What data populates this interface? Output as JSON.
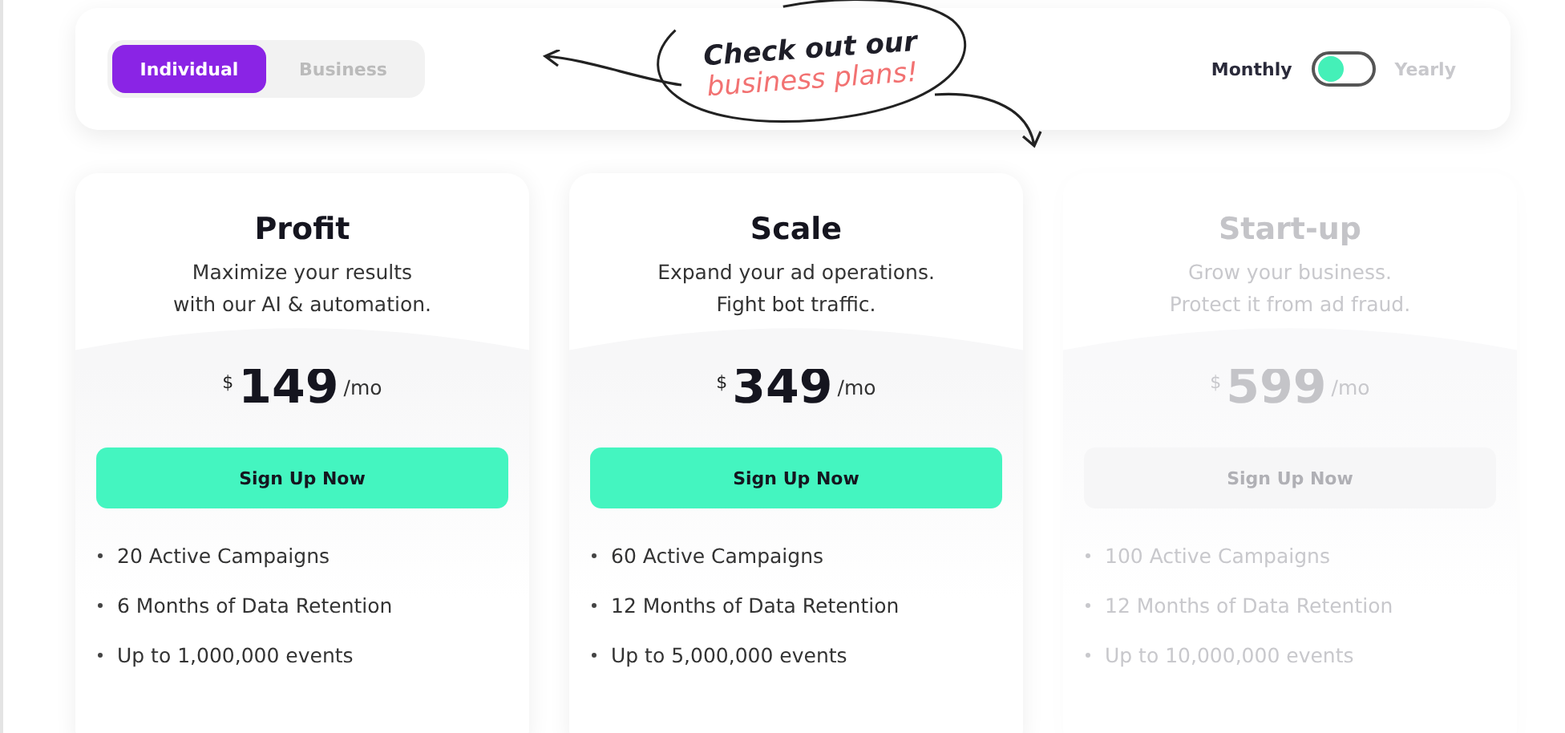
{
  "audience_tabs": [
    {
      "label": "Individual",
      "selected": true
    },
    {
      "label": "Business",
      "selected": false
    }
  ],
  "callout": {
    "line_1": "Check out our",
    "line_2": "business plans!"
  },
  "billing": {
    "monthly_label": "Monthly",
    "yearly_label": "Yearly",
    "yearly": false
  },
  "plans": [
    {
      "name": "Profit",
      "description": [
        "Maximize your results",
        "with our AI & automation."
      ],
      "currency": "$",
      "price": "149",
      "period": "/mo",
      "button": "Sign Up Now",
      "faded": false,
      "features": [
        "20 Active Campaigns",
        "6 Months of Data Retention",
        "Up to 1,000,000 events"
      ]
    },
    {
      "name": "Scale",
      "description": [
        "Expand your ad operations.",
        "Fight bot traffic."
      ],
      "currency": "$",
      "price": "349",
      "period": "/mo",
      "button": "Sign Up Now",
      "faded": false,
      "features": [
        "60 Active Campaigns",
        "12 Months of Data Retention",
        "Up to 5,000,000 events"
      ]
    },
    {
      "name": "Start-up",
      "description": [
        "Grow your business.",
        "Protect it from ad fraud."
      ],
      "currency": "$",
      "price": "599",
      "period": "/mo",
      "button": "Sign Up Now",
      "faded": true,
      "features": [
        "100 Active Campaigns",
        "12 Months of Data Retention",
        "Up to 10,000,000 events"
      ]
    }
  ]
}
